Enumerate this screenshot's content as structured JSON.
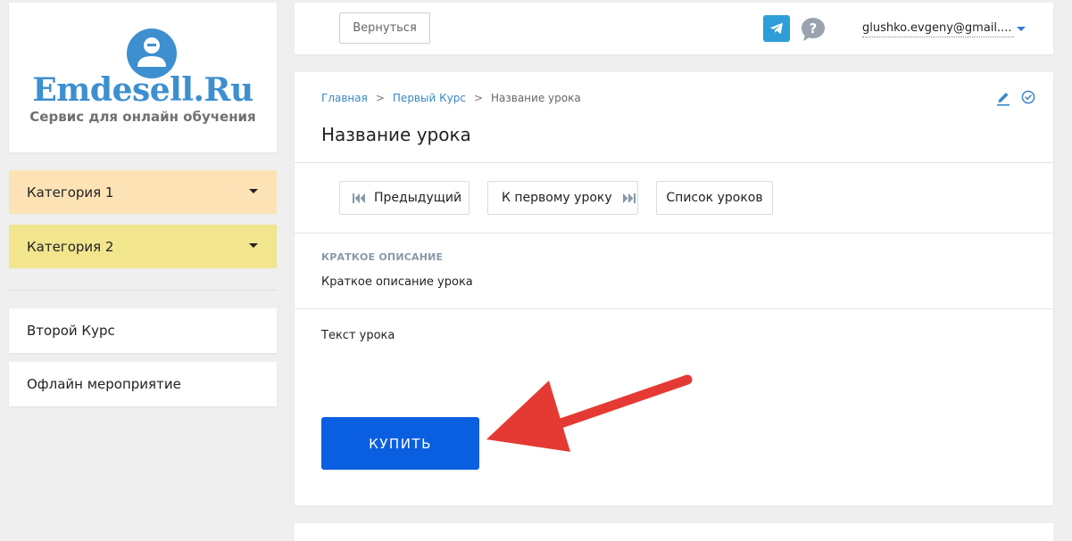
{
  "sidebar": {
    "logo_title": "Emdesell.Ru",
    "logo_tagline": "Сервис для онлайн обучения",
    "categories": [
      {
        "label": "Категория 1",
        "color": "#fde2b5"
      },
      {
        "label": "Категория 2",
        "color": "#f1e58e"
      }
    ],
    "links": [
      {
        "label": "Второй Курс"
      },
      {
        "label": "Офлайн мероприятие"
      }
    ]
  },
  "header": {
    "back_label": "Вернуться",
    "telegram_icon": "telegram-icon",
    "help_icon": "question-icon",
    "user_email": "glushko.evgeny@gmail....",
    "accent": "#2e7bd6"
  },
  "main": {
    "breadcrumb": [
      {
        "label": "Главная"
      },
      {
        "label": "Первый Курс"
      },
      {
        "label": "Название урока"
      }
    ],
    "breadcrumb_separator": ">",
    "title": "Название урока",
    "nav": {
      "prev_label": "Предыдущий",
      "first_label": "К первому уроку",
      "list_label": "Список уроков"
    },
    "description_heading": "КРАТКОЕ ОПИСАНИЕ",
    "description_text": "Краткое описание урока",
    "body_text": "Текст урока",
    "buy_label": "КУПИТЬ",
    "buy_color": "#0a5fe0",
    "annotation_color": "#e53a33"
  }
}
